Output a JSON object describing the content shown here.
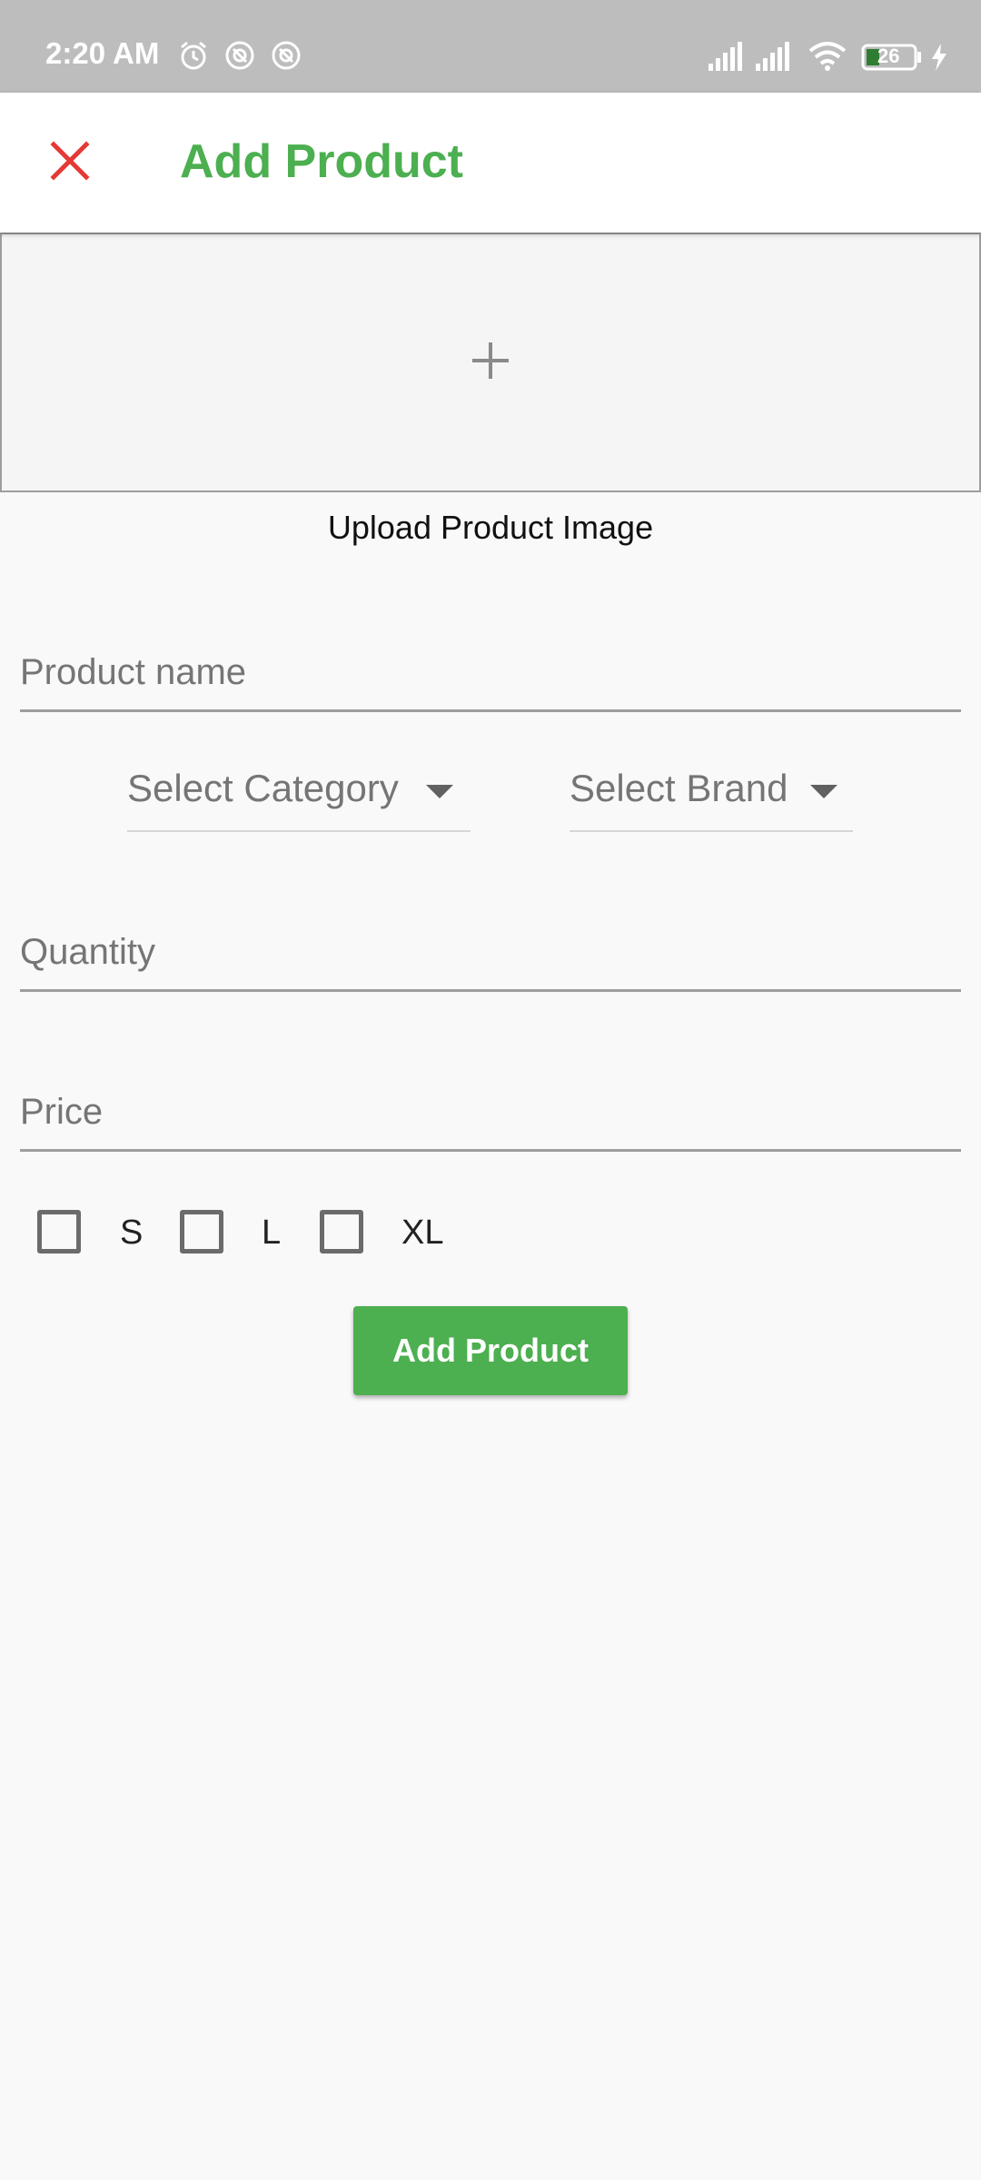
{
  "status_bar": {
    "time": "2:20 AM",
    "battery_level": "26",
    "icons": [
      "alarm-icon",
      "sync-icon",
      "sync-icon",
      "signal-icon",
      "signal-icon",
      "wifi-icon",
      "battery-icon",
      "charging-icon"
    ]
  },
  "app_bar": {
    "title": "Add Product",
    "close_icon": "close-icon"
  },
  "image_upload": {
    "icon": "plus-icon",
    "label": "Upload Product Image"
  },
  "form": {
    "product_name": {
      "placeholder": "Product name",
      "value": ""
    },
    "category": {
      "label": "Select Category"
    },
    "brand": {
      "label": "Select Brand"
    },
    "quantity": {
      "placeholder": "Quantity",
      "value": ""
    },
    "price": {
      "placeholder": "Price",
      "value": ""
    },
    "sizes": [
      {
        "label": "S",
        "checked": false
      },
      {
        "label": "L",
        "checked": false
      },
      {
        "label": "XL",
        "checked": false
      }
    ],
    "submit_label": "Add Product"
  },
  "colors": {
    "accent": "#4caf50",
    "close": "#e53935",
    "status_bar": "#bdbdbd",
    "background": "#f9f9f9"
  }
}
